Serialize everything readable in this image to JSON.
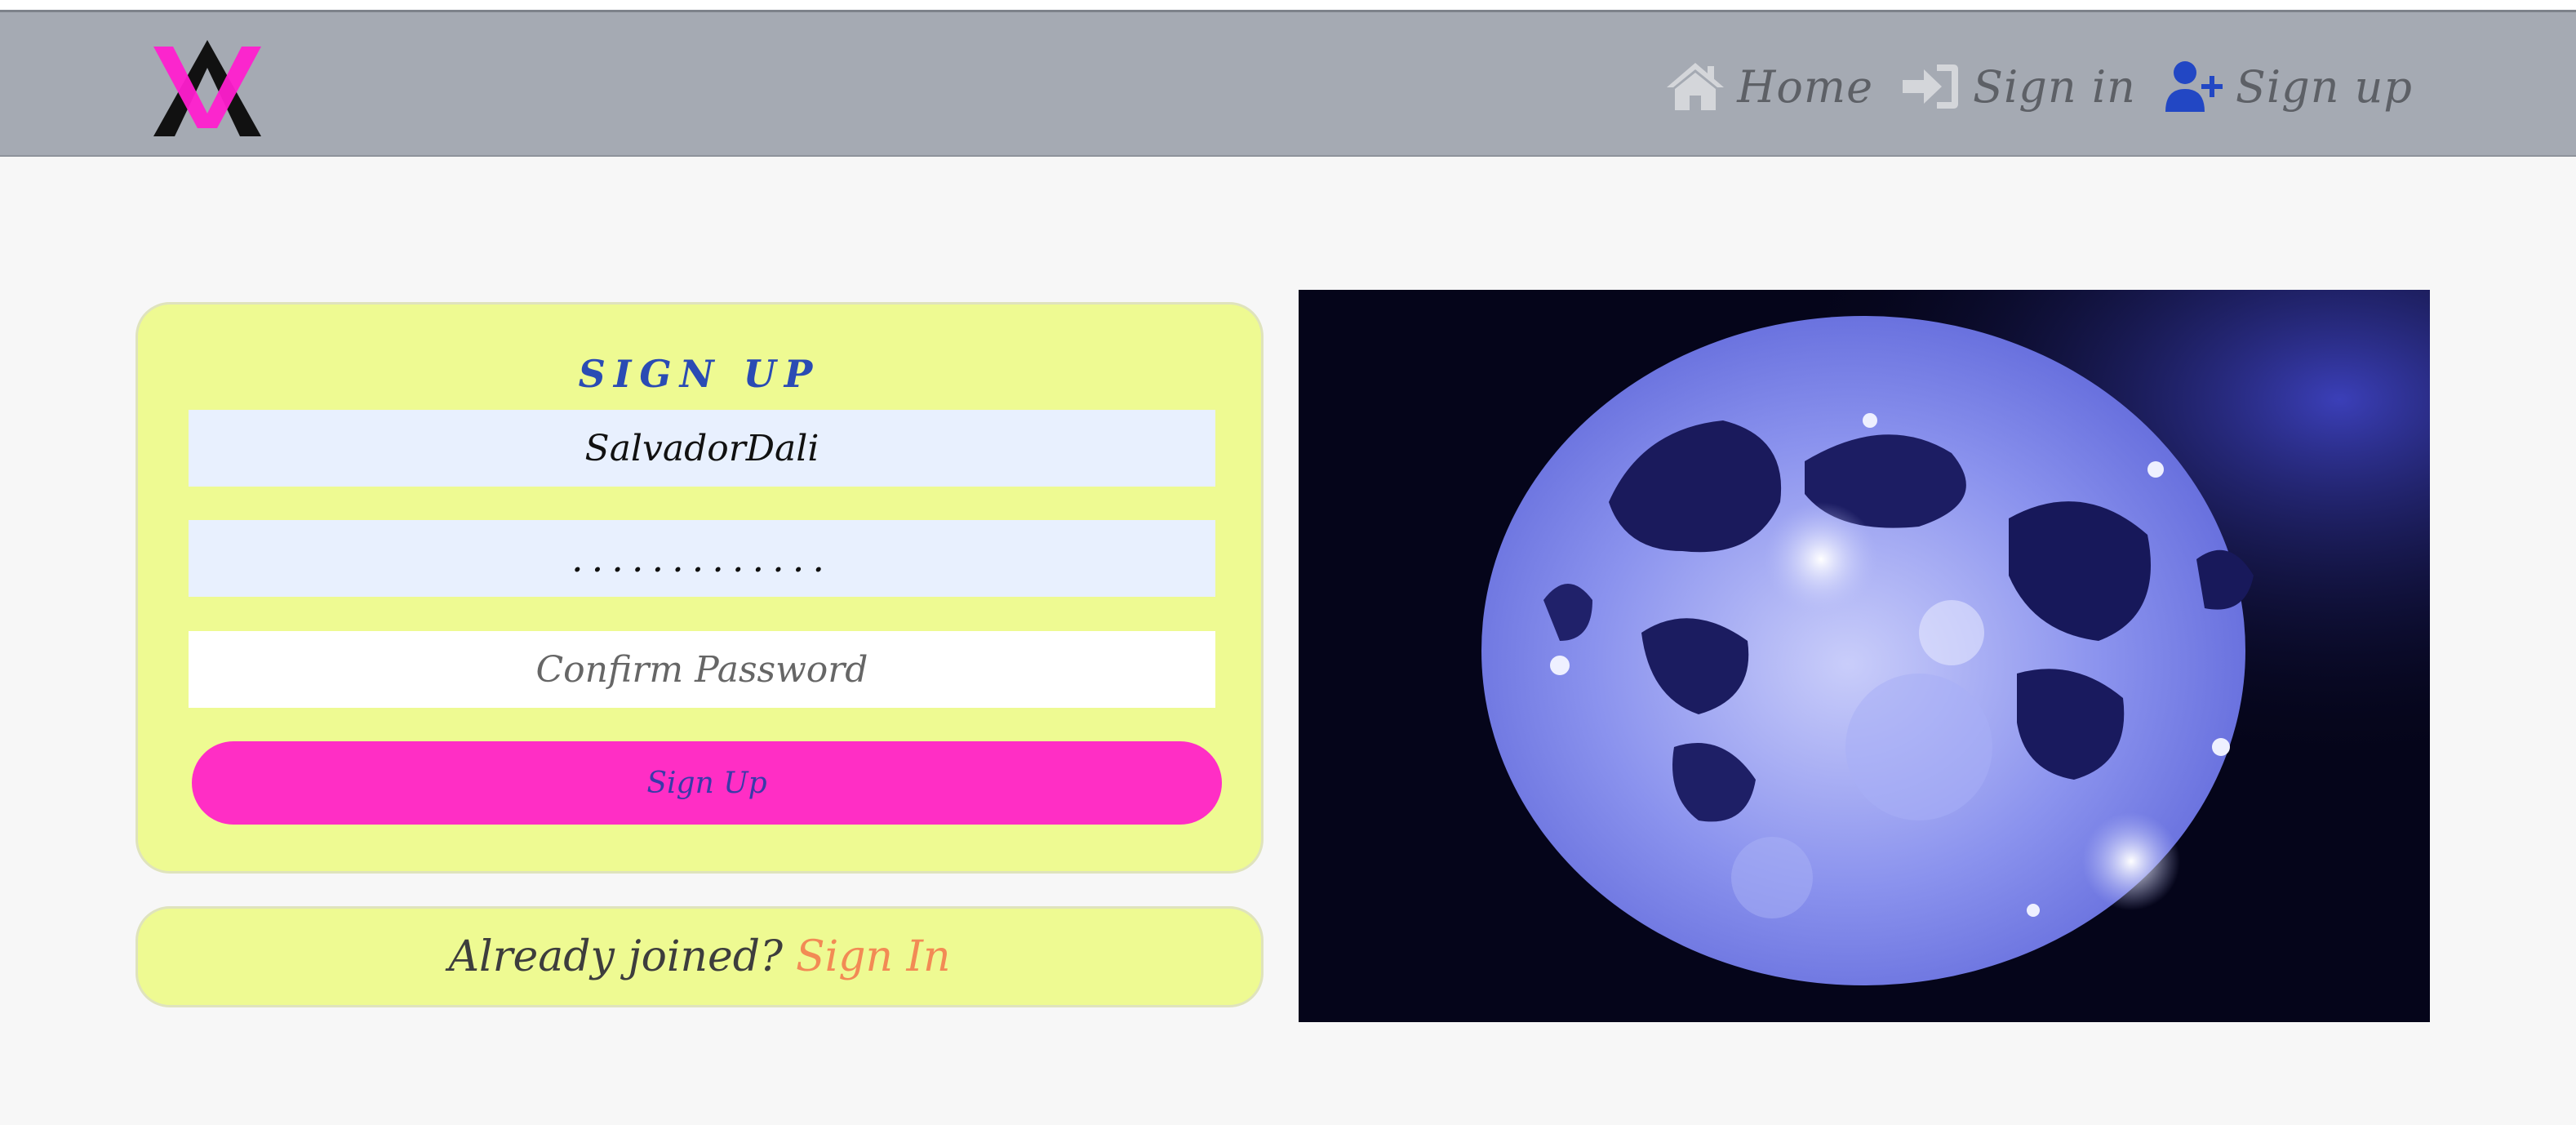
{
  "header": {
    "logo_alt": "AV",
    "nav": [
      {
        "label": "Home",
        "icon": "home-icon"
      },
      {
        "label": "Sign in",
        "icon": "sign-in-icon"
      },
      {
        "label": "Sign up",
        "icon": "user-plus-icon"
      }
    ]
  },
  "signup": {
    "title": "SIGN UP",
    "username_value": "SalvadorDali",
    "password_value": ".............",
    "confirm_placeholder": "Confirm Password",
    "submit_label": "Sign Up"
  },
  "signin_prompt": {
    "question": "Already joined?",
    "link": "Sign In"
  },
  "hero": {
    "image": "moon-painting"
  },
  "colors": {
    "navbar": "#a5aab3",
    "card": "#eefa92",
    "accent_pink": "#ff2ec5",
    "title_blue": "#2a4bb4",
    "link_orange": "#f28a55",
    "icon_blue": "#2247c4"
  }
}
